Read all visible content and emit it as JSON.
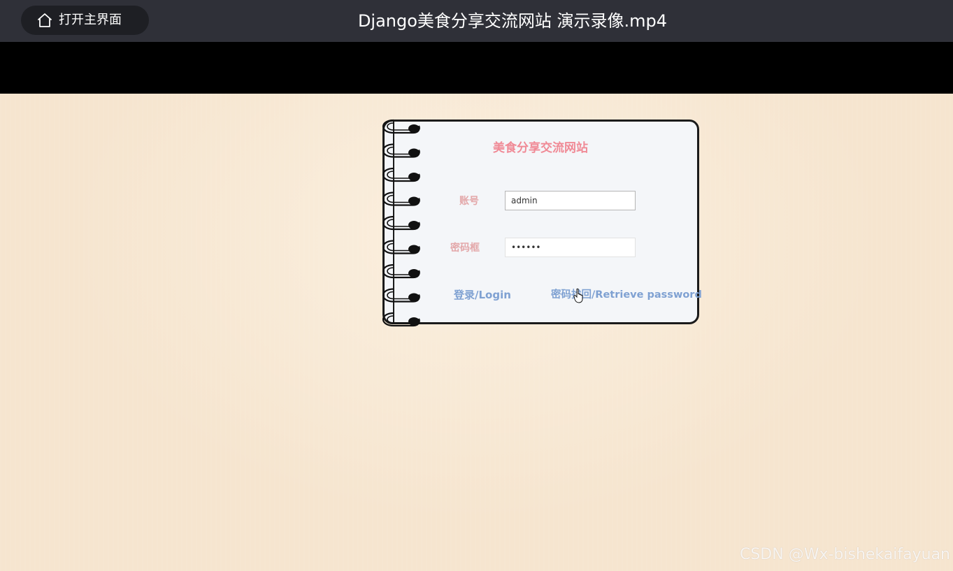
{
  "player": {
    "home_button_label": "打开主界面",
    "home_icon": "home-icon",
    "video_title": "Django美食分享交流网站 演示录像.mp4"
  },
  "login_card": {
    "site_title": "美食分享交流网站",
    "account_label": "账号",
    "account_value": "admin",
    "password_label": "密码框",
    "password_value": "••••••",
    "login_link": "登录/Login",
    "retrieve_link": "密码找回/Retrieve password",
    "spiral_icon": "spiral-binding-icon",
    "cursor_icon": "hand-cursor-icon"
  },
  "watermark": "CSDN @Wx-bishekaifayuan",
  "colors": {
    "topbar": "#2f3038",
    "background": "#f6e5cf",
    "title_pink": "#f08a96",
    "label_pink": "#e3a7a9",
    "link_blue": "#7fa1d2"
  }
}
